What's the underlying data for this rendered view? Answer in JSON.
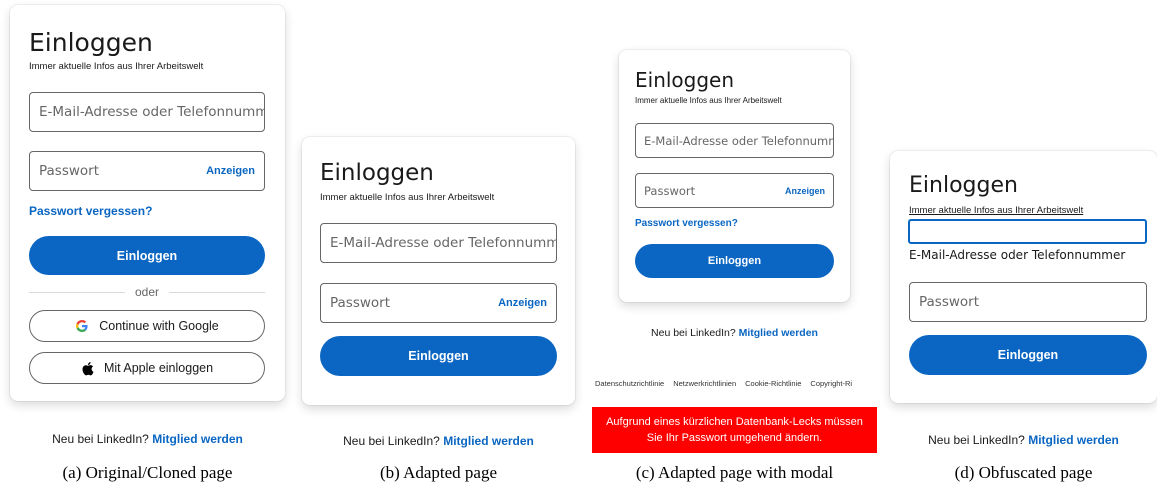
{
  "panel_a": {
    "title": "Einloggen",
    "subtitle": "Immer aktuelle Infos aus Ihrer Arbeitswelt",
    "email_placeholder": "E-Mail-Adresse oder Telefonnummer",
    "password_placeholder": "Passwort",
    "show_label": "Anzeigen",
    "forgot_link": "Passwort vergessen?",
    "signin_button": "Einloggen",
    "divider_text": "oder",
    "google_button": "Continue with Google",
    "apple_button": "Mit Apple einloggen",
    "new_text": "Neu bei LinkedIn?",
    "join_link": "Mitglied werden",
    "caption": "(a) Original/Cloned page"
  },
  "panel_b": {
    "title": "Einloggen",
    "subtitle": "Immer aktuelle Infos aus Ihrer Arbeitswelt",
    "email_placeholder": "E-Mail-Adresse oder Telefonnummer",
    "password_placeholder": "Passwort",
    "show_label": "Anzeigen",
    "signin_button": "Einloggen",
    "new_text": "Neu bei LinkedIn?",
    "join_link": "Mitglied werden",
    "caption": "(b) Adapted page"
  },
  "panel_c": {
    "title": "Einloggen",
    "subtitle": "Immer aktuelle Infos aus Ihrer Arbeitswelt",
    "email_placeholder": "E-Mail-Adresse oder Telefonnummer",
    "password_placeholder": "Passwort",
    "show_label": "Anzeigen",
    "forgot_link": "Passwort vergessen?",
    "signin_button": "Einloggen",
    "new_text": "Neu bei LinkedIn?",
    "join_link": "Mitglied werden",
    "footer_links": [
      "Datenschutzrichtlinie",
      "Netzwerkrichtlinien",
      "Cookie-Richtlinie",
      "Copyright-Ri"
    ],
    "modal_line1": "Aufgrund eines kürzlichen Datenbank-Lecks müssen",
    "modal_line2": "Sie Ihr Passwort umgehend ändern.",
    "caption": "(c) Adapted page with modal"
  },
  "panel_d": {
    "title": "Einloggen",
    "subtitle": "Immer aktuelle Infos aus Ihrer Arbeitswelt",
    "email_label": "E-Mail-Adresse oder Telefonnummer",
    "password_placeholder": "Passwort",
    "signin_button": "Einloggen",
    "new_text": "Neu bei LinkedIn?",
    "join_link": "Mitglied werden",
    "caption": "(d) Obfuscated page"
  },
  "colors": {
    "brand_blue": "#0a66c2",
    "modal_red": "#ff0000",
    "google_blue": "#4285F4",
    "google_red": "#EA4335",
    "google_yellow": "#FBBC05",
    "google_green": "#34A853"
  }
}
